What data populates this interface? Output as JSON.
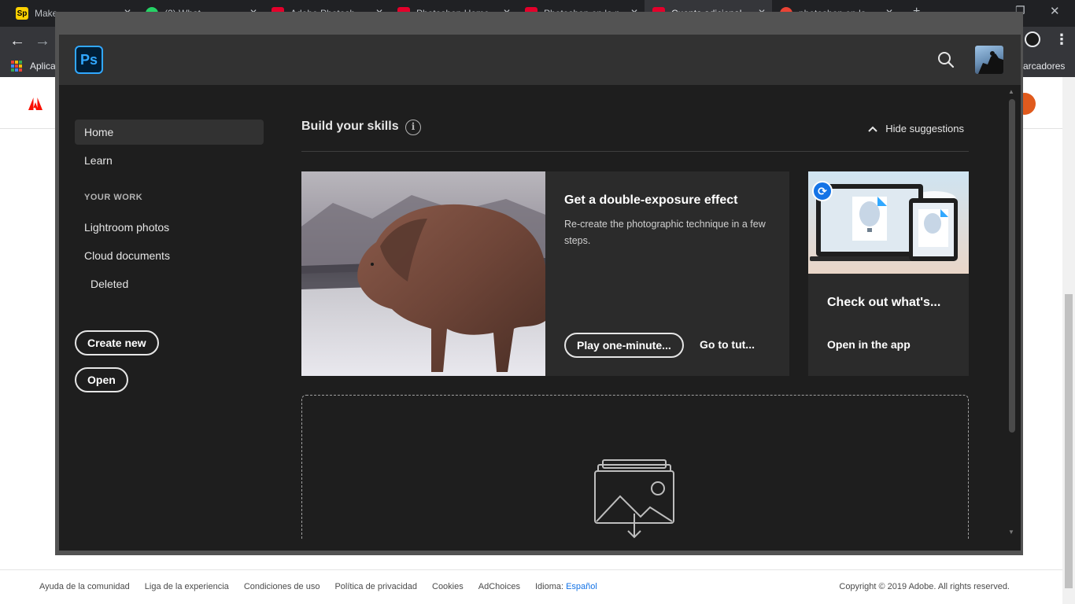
{
  "browser": {
    "tabs": [
      {
        "title": "Make",
        "fav_color": "#ffd100",
        "fav_text": "Sp"
      },
      {
        "title": "(2) What",
        "fav_color": "#25d366",
        "fav_text": ""
      },
      {
        "title": "Adobe Photosh",
        "fav_color": "#e4002b",
        "fav_text": ""
      },
      {
        "title": "Photoshop Home",
        "fav_color": "#e4002b",
        "fav_text": ""
      },
      {
        "title": "Photoshop en la n",
        "fav_color": "#e4002b",
        "fav_text": ""
      },
      {
        "title": "Cuenta adicional",
        "fav_color": "#e4002b",
        "fav_text": ""
      },
      {
        "title": "photoshop en la",
        "fav_color": "#e4002b",
        "fav_text": ""
      }
    ],
    "bookmarks_apps": "Aplica",
    "bookmarks_right": "arcadores"
  },
  "ps": {
    "logo": "Ps",
    "sidebar": {
      "home": "Home",
      "learn": "Learn",
      "section": "YOUR WORK",
      "lightroom": "Lightroom photos",
      "cloud": "Cloud documents",
      "deleted": "Deleted",
      "create_new": "Create new",
      "open": "Open"
    },
    "main": {
      "skills_title": "Build your skills",
      "info": "i",
      "hide_suggestions": "Hide suggestions",
      "card1": {
        "title": "Get a double-exposure effect",
        "desc": "Re-create the photographic technique in a few steps.",
        "play": "Play one-minute...",
        "link": "Go to tut..."
      },
      "card2": {
        "title": "Check out what's...",
        "link": "Open in the app"
      }
    }
  },
  "footer": {
    "links": [
      "Ayuda de la comunidad",
      "Liga de la experiencia",
      "Condiciones de uso",
      "Política de privacidad",
      "Cookies",
      "AdChoices"
    ],
    "lang_label": "Idioma: ",
    "lang_value": "Español",
    "copyright": "Copyright © 2019 Adobe. All rights reserved."
  },
  "colors": {
    "ps_accent": "#31a8ff",
    "ps_bg": "#1e1e1e",
    "adobe_red": "#fa0f00"
  }
}
